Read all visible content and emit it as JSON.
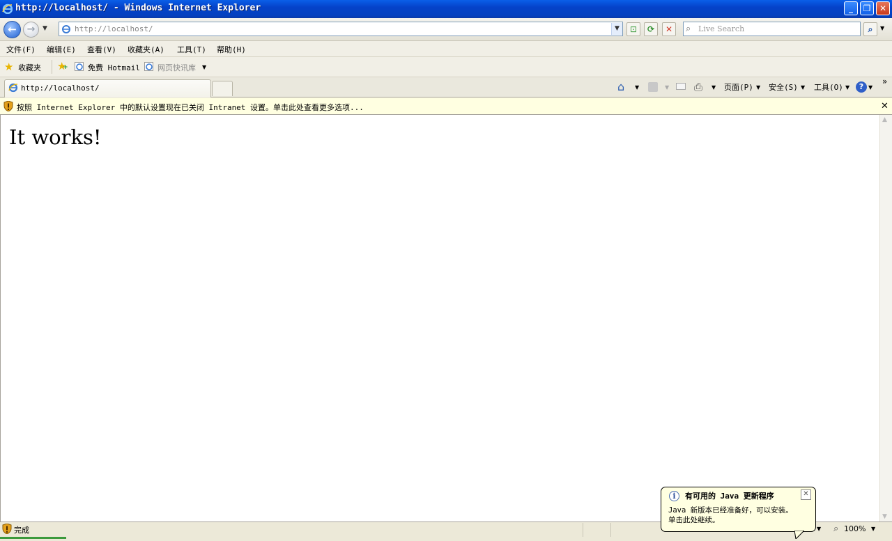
{
  "window": {
    "title": "http://localhost/ - Windows Internet Explorer",
    "minimize_icon": "minimize-icon",
    "maximize_icon": "restore-icon",
    "close_icon": "close-icon"
  },
  "navbar": {
    "address": "http://localhost/",
    "search_placeholder": "Live Search"
  },
  "menu": {
    "items": [
      "文件(F)",
      "编辑(E)",
      "查看(V)",
      "收藏夹(A)",
      "工具(T)",
      "帮助(H)"
    ]
  },
  "favorites": {
    "favorites_label": "收藏夹",
    "links": [
      "免费 Hotmail",
      "网页快讯库"
    ]
  },
  "tabs": {
    "active_tab": "http://localhost/"
  },
  "command_bar": {
    "page_label": "页面(P)",
    "safety_label": "安全(S)",
    "tools_label": "工具(O)"
  },
  "infobar": {
    "message": "按照 Internet Explorer 中的默认设置现在已关闭 Intranet 设置。单击此处查看更多选项..."
  },
  "page": {
    "heading": "It works!"
  },
  "status": {
    "text": "完成",
    "zoom": "100%"
  },
  "balloon": {
    "title": "有可用的 Java 更新程序",
    "line1": "Java 新版本已经准备好，可以安装。",
    "line2": "单击此处继续。"
  },
  "colors": {
    "titlebar": "#0542c9",
    "infobar": "#ffffe1",
    "chrome": "#ece9d8"
  }
}
